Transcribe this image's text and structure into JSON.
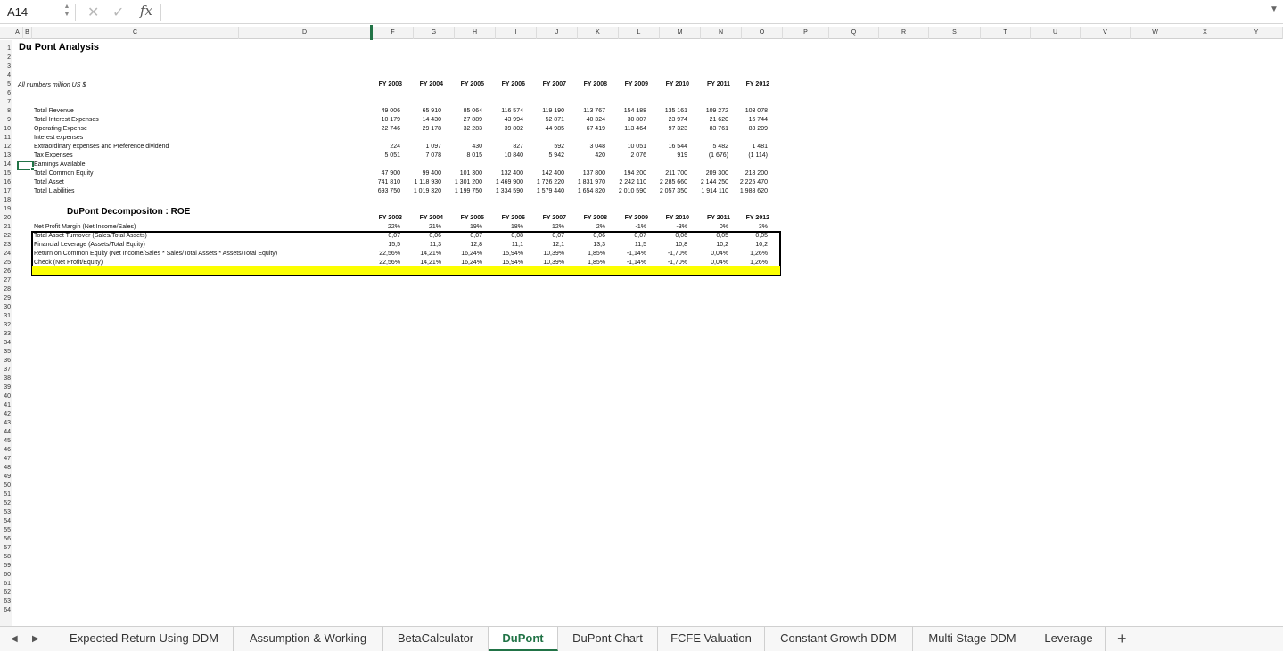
{
  "formula_bar": {
    "name_box": "A14",
    "formula": ""
  },
  "columns": [
    "A",
    "B",
    "C",
    "D",
    "F",
    "G",
    "H",
    "I",
    "J",
    "K",
    "L",
    "M",
    "N",
    "O",
    "P",
    "Q",
    "R",
    "S",
    "T",
    "U",
    "V",
    "W",
    "X",
    "Y"
  ],
  "title": "Du Pont Analysis",
  "units_note": "All numbers million US $",
  "years": [
    "FY 2003",
    "FY 2004",
    "FY 2005",
    "FY 2006",
    "FY 2007",
    "FY 2008",
    "FY 2009",
    "FY 2010",
    "FY 2011",
    "FY 2012"
  ],
  "data_rows": [
    {
      "row": 8,
      "label": "Total Revenue",
      "values": [
        "49 006",
        "65 910",
        "85 064",
        "116 574",
        "119 190",
        "113 767",
        "154 188",
        "135 161",
        "109 272",
        "103 078"
      ]
    },
    {
      "row": 9,
      "label": "Total Interest Expenses",
      "values": [
        "10 179",
        "14 430",
        "27 889",
        "43 994",
        "52 871",
        "40 324",
        "30 807",
        "23 974",
        "21 620",
        "16 744"
      ]
    },
    {
      "row": 10,
      "label": "Operating Expense",
      "values": [
        "22 746",
        "29 178",
        "32 283",
        "39 802",
        "44 985",
        "67 419",
        "113 464",
        "97 323",
        "83 761",
        "83 209"
      ]
    },
    {
      "row": 11,
      "label": "Interest expenses",
      "values": [
        "",
        "",
        "",
        "",
        "",
        "",
        "",
        "",
        "",
        ""
      ]
    },
    {
      "row": 12,
      "label": "Extraordinary expenses and Preference dividend",
      "values": [
        "224",
        "1 097",
        "430",
        "827",
        "592",
        "3 048",
        "10 051",
        "16 544",
        "5 482",
        "1 481"
      ]
    },
    {
      "row": 13,
      "label": "Tax Expenses",
      "values": [
        "5 051",
        "7 078",
        "8 015",
        "10 840",
        "5 942",
        "420",
        "2 076",
        "919",
        "(1 676)",
        "(1 114)"
      ]
    },
    {
      "row": 14,
      "label": "Earnings Available",
      "values": [
        "",
        "",
        "",
        "",
        "",
        "",
        "",
        "",
        "",
        ""
      ]
    },
    {
      "row": 15,
      "label": "Total Common Equity",
      "values": [
        "47 900",
        "99 400",
        "101 300",
        "132 400",
        "142 400",
        "137 800",
        "194 200",
        "211 700",
        "209 300",
        "218 200"
      ]
    },
    {
      "row": 16,
      "label": "Total Asset",
      "values": [
        "741 810",
        "1 118 930",
        "1 301 200",
        "1 469 900",
        "1 726 220",
        "1 831 970",
        "2 242 110",
        "2 285 660",
        "2 144 250",
        "2 225 470"
      ]
    },
    {
      "row": 17,
      "label": "Total Liabilities",
      "values": [
        "693 750",
        "1 019 320",
        "1 199 750",
        "1 334 590",
        "1 579 440",
        "1 654 820",
        "2 010 590",
        "2 057 350",
        "1 914 110",
        "1 988 620"
      ]
    }
  ],
  "subtitle": "DuPont Decompositon : ROE",
  "decomp_rows": [
    {
      "row": 21,
      "label": "Net Profit Margin (Net Income/Sales)",
      "values": [
        "22%",
        "21%",
        "19%",
        "18%",
        "12%",
        "2%",
        "-1%",
        "-3%",
        "0%",
        "3%"
      ]
    },
    {
      "row": 22,
      "label": "Total Asset Turnover (Sales/Total Assets)",
      "values": [
        "0,07",
        "0,06",
        "0,07",
        "0,08",
        "0,07",
        "0,06",
        "0,07",
        "0,06",
        "0,05",
        "0,05"
      ]
    },
    {
      "row": 23,
      "label": "Financial Leverage (Assets/Total Equity)",
      "values": [
        "15,5",
        "11,3",
        "12,8",
        "11,1",
        "12,1",
        "13,3",
        "11,5",
        "10,8",
        "10,2",
        "10,2"
      ]
    },
    {
      "row": 24,
      "label": "Return on Common Equity (Net Income/Sales * Sales/Total Assets * Assets/Total Equity)",
      "values": [
        "22,56%",
        "14,21%",
        "16,24%",
        "15,94%",
        "10,39%",
        "1,85%",
        "-1,14%",
        "-1,70%",
        "0,04%",
        "1,26%"
      ]
    },
    {
      "row": 25,
      "label": "Check (Net Profit/Equity)",
      "values": [
        "22,56%",
        "14,21%",
        "16,24%",
        "15,94%",
        "10,39%",
        "1,85%",
        "-1,14%",
        "-1,70%",
        "0,04%",
        "1,26%"
      ]
    }
  ],
  "sheet_tabs": [
    {
      "label": "Expected Return Using DDM",
      "active": false
    },
    {
      "label": "Assumption & Working",
      "active": false
    },
    {
      "label": "BetaCalculator",
      "active": false
    },
    {
      "label": "DuPont",
      "active": true
    },
    {
      "label": "DuPont Chart",
      "active": false
    },
    {
      "label": "FCFE Valuation",
      "active": false
    },
    {
      "label": "Constant Growth DDM",
      "active": false
    },
    {
      "label": "Multi Stage DDM",
      "active": false
    },
    {
      "label": "Leverage",
      "active": false
    }
  ],
  "colors": {
    "accent": "#217346",
    "highlight": "#fcff00"
  }
}
